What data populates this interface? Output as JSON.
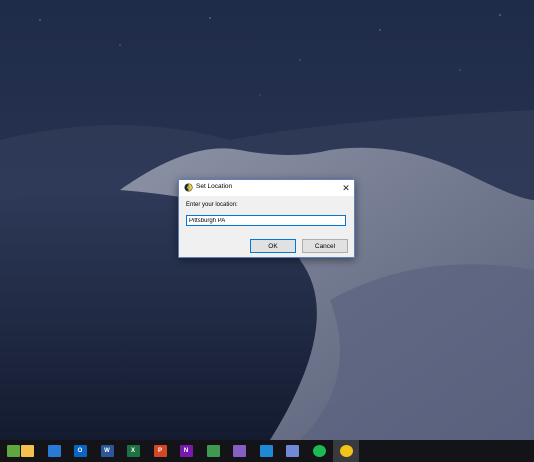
{
  "dialog": {
    "title": "Set Location",
    "close_glyph": "✕",
    "prompt": "Enter your location:",
    "location_value": "Pittsburgh PA",
    "ok_label": "OK",
    "cancel_label": "Cancel"
  },
  "taskbar": {
    "items": [
      {
        "name": "green-app-icon",
        "color": "#5ea83f",
        "glyph": ""
      },
      {
        "name": "file-explorer-icon",
        "color": "#f2c14e",
        "glyph": ""
      },
      {
        "name": "store-icon",
        "color": "#2b79d6",
        "glyph": ""
      },
      {
        "name": "outlook-icon",
        "color": "#0a64c4",
        "glyph": "O"
      },
      {
        "name": "word-icon",
        "color": "#2b579a",
        "glyph": "W"
      },
      {
        "name": "excel-icon",
        "color": "#1e7145",
        "glyph": "X"
      },
      {
        "name": "powerpoint-icon",
        "color": "#d24726",
        "glyph": "P"
      },
      {
        "name": "onenote-icon",
        "color": "#7719aa",
        "glyph": "N"
      },
      {
        "name": "sketch-app-icon",
        "color": "#3d9a50",
        "glyph": ""
      },
      {
        "name": "visual-studio-icon",
        "color": "#865fc5",
        "glyph": ""
      },
      {
        "name": "vscode-icon",
        "color": "#1e8ad6",
        "glyph": ""
      },
      {
        "name": "discord-icon",
        "color": "#7289da",
        "glyph": ""
      },
      {
        "name": "spotify-icon",
        "color": "#1db954",
        "glyph": ""
      },
      {
        "name": "weather-app-icon",
        "color": "#f0c419",
        "glyph": ""
      }
    ]
  }
}
